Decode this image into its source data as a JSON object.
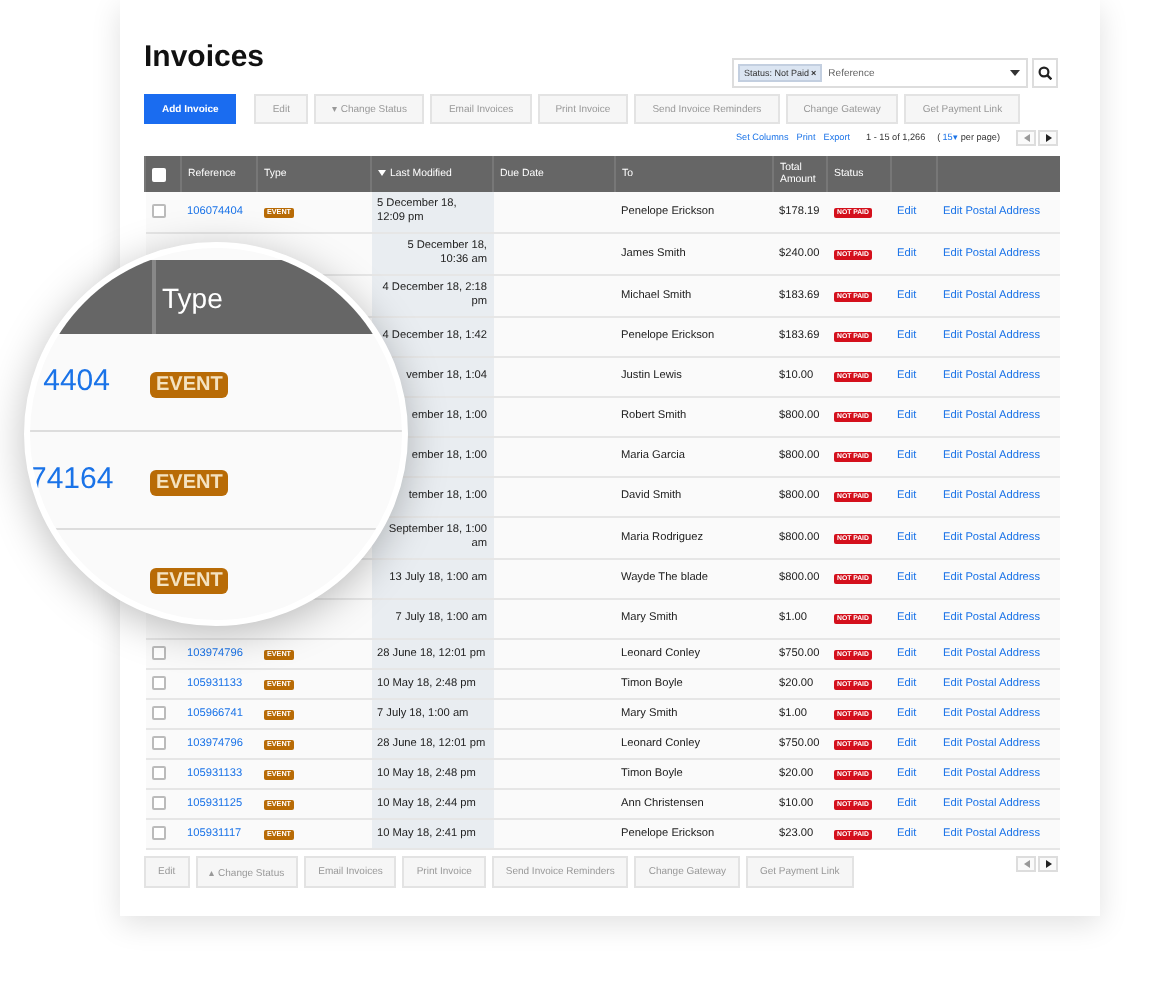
{
  "title": "Invoices",
  "search": {
    "chip": "Status: Not Paid",
    "chip_close": "×",
    "placeholder": "Reference"
  },
  "toolbar": [
    {
      "label": "Add Invoice",
      "primary": true,
      "disabled": false
    },
    {
      "label": "Edit",
      "primary": false,
      "disabled": true
    },
    {
      "label": "Change Status",
      "caret": "▾",
      "primary": false,
      "disabled": true
    },
    {
      "label": "Email Invoices",
      "primary": false,
      "disabled": true
    },
    {
      "label": "Print Invoice",
      "primary": false,
      "disabled": true
    },
    {
      "label": "Send Invoice Reminders",
      "primary": false,
      "disabled": true
    },
    {
      "label": "Change Gateway",
      "primary": false,
      "disabled": true
    },
    {
      "label": "Get Payment Link",
      "primary": false,
      "disabled": true
    }
  ],
  "links": [
    "Set Columns",
    "Print",
    "Export"
  ],
  "range": "1 - 15 of 1,266",
  "per_page": {
    "open": "(",
    "value": "15▾",
    "rest": "per page)"
  },
  "table": {
    "select_all": {
      "checked": false
    },
    "columns": [
      {
        "label": "Reference",
        "sorted": false
      },
      {
        "label": "Type",
        "sorted": false
      },
      {
        "label": "Last Modified",
        "sorted": true
      },
      {
        "label": "Due Date",
        "sorted": false
      },
      {
        "label": "To",
        "sorted": false
      },
      {
        "label": "Total Amount",
        "sorted": false
      },
      {
        "label": "Status",
        "sorted": false
      }
    ],
    "rows": [
      {
        "checked": false,
        "reference": "106074404",
        "type": "EVENT",
        "modified": "5 December 18, 12:09 pm",
        "to": "Penelope Erickson",
        "total": "$178.19",
        "status": "NOT PAID",
        "edit": "Edit",
        "postal": "Edit Postal Address"
      },
      {
        "modified": "5 December 18, 10:36 am",
        "to": "James Smith",
        "total": "$240.00",
        "status": "NOT PAID",
        "edit": "Edit",
        "postal": "Edit Postal Address"
      },
      {
        "modified": "4 December 18, 2:18 pm",
        "to": "Michael Smith",
        "total": "$183.69",
        "status": "NOT PAID",
        "edit": "Edit",
        "postal": "Edit Postal Address"
      },
      {
        "modified": "4 December 18, 1:42",
        "to": "Penelope Erickson",
        "total": "$183.69",
        "status": "NOT PAID",
        "edit": "Edit",
        "postal": "Edit Postal Address"
      },
      {
        "modified": "vember 18, 1:04",
        "to": "Justin Lewis",
        "total": "$10.00",
        "status": "NOT PAID",
        "edit": "Edit",
        "postal": "Edit Postal Address"
      },
      {
        "modified": "ember 18, 1:00",
        "to": "Robert Smith",
        "total": "$800.00",
        "status": "NOT PAID",
        "edit": "Edit",
        "postal": "Edit Postal Address"
      },
      {
        "modified": "ember 18, 1:00",
        "to": "Maria Garcia",
        "total": "$800.00",
        "status": "NOT PAID",
        "edit": "Edit",
        "postal": "Edit Postal Address"
      },
      {
        "modified": "tember 18, 1:00",
        "to": "David Smith",
        "total": "$800.00",
        "status": "NOT PAID",
        "edit": "Edit",
        "postal": "Edit Postal Address"
      },
      {
        "modified": "September 18, 1:00 am",
        "to": "Maria Rodriguez",
        "total": "$800.00",
        "status": "NOT PAID",
        "edit": "Edit",
        "postal": "Edit Postal Address"
      },
      {
        "modified": "13 July 18, 1:00 am",
        "to": "Wayde The blade",
        "total": "$800.00",
        "status": "NOT PAID",
        "edit": "Edit",
        "postal": "Edit Postal Address"
      },
      {
        "modified": "7 July 18, 1:00 am",
        "to": "Mary Smith",
        "total": "$1.00",
        "status": "NOT PAID",
        "edit": "Edit",
        "postal": "Edit Postal Address"
      },
      {
        "checked": false,
        "reference": "103974796",
        "type": "EVENT",
        "modified": "28 June 18, 12:01 pm",
        "to": "Leonard Conley",
        "total": "$750.00",
        "status": "NOT PAID",
        "edit": "Edit",
        "postal": "Edit Postal Address"
      },
      {
        "checked": false,
        "reference": "105931133",
        "type": "EVENT",
        "modified": "10 May 18, 2:48 pm",
        "to": "Timon Boyle",
        "total": "$20.00",
        "status": "NOT PAID",
        "edit": "Edit",
        "postal": "Edit Postal Address"
      },
      {
        "checked": false,
        "reference": "105966741",
        "type": "EVENT",
        "modified": "7 July 18, 1:00 am",
        "to": "Mary Smith",
        "total": "$1.00",
        "status": "NOT PAID",
        "edit": "Edit",
        "postal": "Edit Postal Address"
      },
      {
        "checked": false,
        "reference": "103974796",
        "type": "EVENT",
        "modified": "28 June 18, 12:01 pm",
        "to": "Leonard Conley",
        "total": "$750.00",
        "status": "NOT PAID",
        "edit": "Edit",
        "postal": "Edit Postal Address"
      },
      {
        "checked": false,
        "reference": "105931133",
        "type": "EVENT",
        "modified": "10 May 18, 2:48 pm",
        "to": "Timon Boyle",
        "total": "$20.00",
        "status": "NOT PAID",
        "edit": "Edit",
        "postal": "Edit Postal Address"
      },
      {
        "checked": false,
        "reference": "105931125",
        "type": "EVENT",
        "modified": "10 May 18, 2:44 pm",
        "to": "Ann Christensen",
        "total": "$10.00",
        "status": "NOT PAID",
        "edit": "Edit",
        "postal": "Edit Postal Address"
      },
      {
        "checked": false,
        "reference": "105931117",
        "type": "EVENT",
        "modified": "10 May 18, 2:41 pm",
        "to": "Penelope Erickson",
        "total": "$23.00",
        "status": "NOT PAID",
        "edit": "Edit",
        "postal": "Edit Postal Address"
      }
    ]
  },
  "bottom_toolbar": [
    {
      "label": "Edit",
      "disabled": true
    },
    {
      "label": "Change Status",
      "caret": "▴",
      "disabled": true
    },
    {
      "label": "Email Invoices",
      "disabled": true
    },
    {
      "label": "Print Invoice",
      "disabled": true
    },
    {
      "label": "Send Invoice Reminders",
      "disabled": true
    },
    {
      "label": "Change Gateway",
      "disabled": true
    },
    {
      "label": "Get Payment Link",
      "disabled": true
    }
  ],
  "magnifier": {
    "header": "Type",
    "rows": [
      {
        "reference": "4404",
        "type": "EVENT"
      },
      {
        "reference": "74164",
        "type": "EVENT"
      },
      {
        "type": "EVENT"
      }
    ]
  }
}
